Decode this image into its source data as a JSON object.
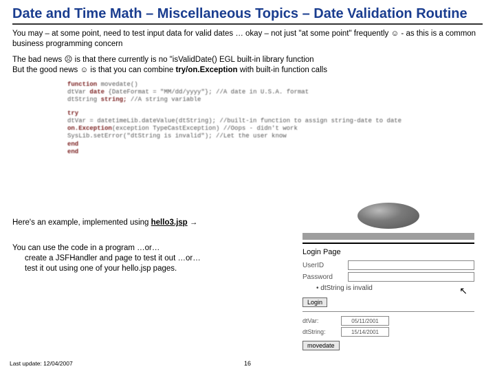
{
  "title": "Date and Time Math – Miscellaneous Topics – Date Validation Routine",
  "p1a": "You may – at some point, need to test input data for valid dates … okay – not just \"at some point\" frequently ",
  "p1_smile": "☺",
  "p1b": " - as this is a common business programming concern",
  "p2a": "The bad news ",
  "p2_frown": "☹",
  "p2b": " is that there currently is no \"isValidDate() EGL built-in library function",
  "p3a": "But the good news ",
  "p3_smile": "☺",
  "p3b": " is that you can combine ",
  "p3_code": "try/on.Exception",
  "p3c": " with built-in function calls",
  "code": {
    "l1a": "function",
    "l1b": " movedate()",
    "l2a": "dtVar",
    "l2b": "    date",
    "l2c": " {DateFormat = \"MM/dd/yyyy\"};",
    "l2d": "   //A date in U.S.A. format",
    "l3a": "dtString",
    "l3b": "  string;",
    "l3c": "                            //A string variable",
    "l4a": "    try",
    "l5": "        dtVar = datetimeLib.dateValue(dtString);   //built-in function to assign string-date to date",
    "l6a": "    on.Exception",
    "l6b": "(exception TypeCastException)       //Oops - didn't work",
    "l7": "        SysLib.setError(\"dtString is invalid\");  //Let the user know",
    "l8a": "    end",
    "l9a": "end"
  },
  "ex_a": "Here's an example, implemented using ",
  "ex_link": "hello3.jsp",
  "ex_arrow": " →",
  "u1": "You can use the code in a program …or…",
  "u2": "create a JSFHandler and page to test it out …or…",
  "u3": "test it out using one of your hello.jsp pages.",
  "login": {
    "title": "Login Page",
    "userid_label": "UserID",
    "password_label": "Password",
    "bullet": "• dtString is invalid",
    "login_btn": "Login",
    "dtvar_label": "dtVar:",
    "dtvar_val": "05/11/2001",
    "dtstr_label": "dtString:",
    "dtstr_val": "15/14/2001",
    "move_btn": "movedate"
  },
  "footer": "Last update: 12/04/2007",
  "page": "16"
}
